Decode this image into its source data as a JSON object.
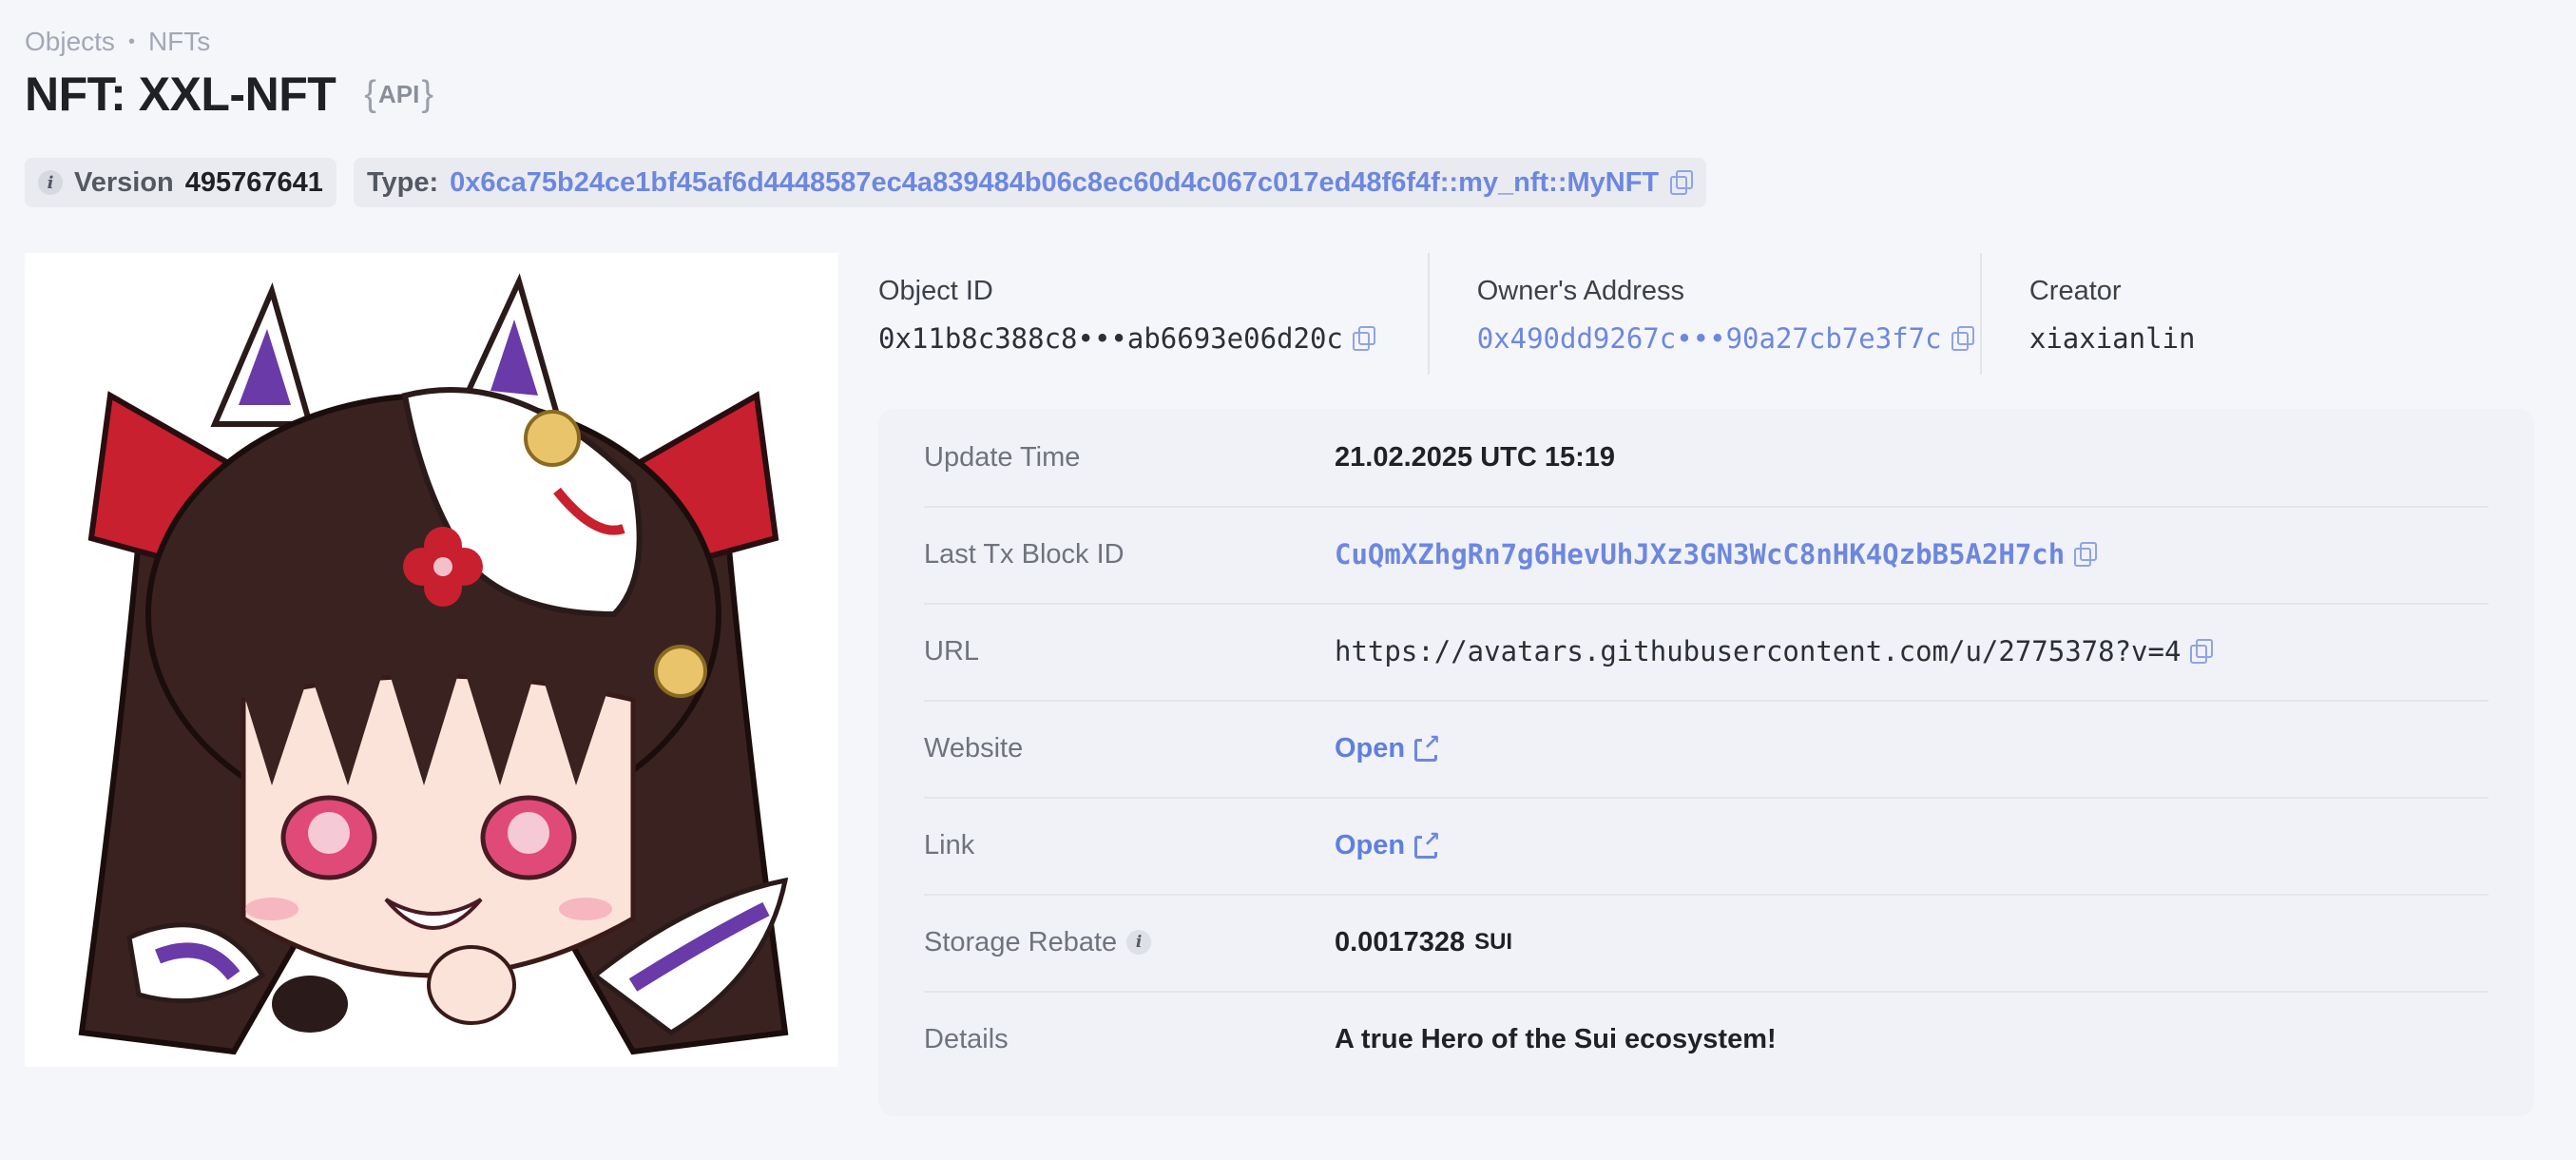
{
  "breadcrumb": {
    "items": [
      "Objects",
      "NFTs"
    ]
  },
  "title": "NFT: XXL-NFT",
  "api_tag": {
    "open": "{",
    "label": "API",
    "close": "}"
  },
  "pills": {
    "version_label": "Version",
    "version_value": "495767641",
    "type_label": "Type:",
    "type_value": "0x6ca75b24ce1bf45af6d4448587ec4a839484b06c8ec60d4c067c017ed48f6f4f::my_nft::MyNFT"
  },
  "header": {
    "object_id_label": "Object ID",
    "object_id_value": "0x11b8c388c8•••ab6693e06d20c",
    "owner_label": "Owner's Address",
    "owner_value": "0x490dd9267c•••90a27cb7e3f7c",
    "creator_label": "Creator",
    "creator_value": "xiaxianlin"
  },
  "details": {
    "update_time_label": "Update Time",
    "update_time_value": "21.02.2025 UTC 15:19",
    "last_tx_label": "Last Tx Block ID",
    "last_tx_value": "CuQmXZhgRn7g6HevUhJXz3GN3WcC8nHK4QzbB5A2H7ch",
    "url_label": "URL",
    "url_value": "https://avatars.githubusercontent.com/u/2775378?v=4",
    "website_label": "Website",
    "website_value": "Open",
    "link_label": "Link",
    "link_value": "Open",
    "storage_rebate_label": "Storage Rebate",
    "storage_rebate_value": "0.0017328",
    "storage_rebate_unit": "SUI",
    "details_label": "Details",
    "details_value": "A true Hero of the Sui ecosystem!"
  },
  "icons": {
    "info": "i",
    "copy": "copy-icon",
    "external_link": "external-link-icon"
  },
  "colors": {
    "background": "#f5f6fa",
    "link": "#6d87e0",
    "card": "#f0f2f7",
    "text": "#1f2125",
    "muted": "#6f737d"
  }
}
